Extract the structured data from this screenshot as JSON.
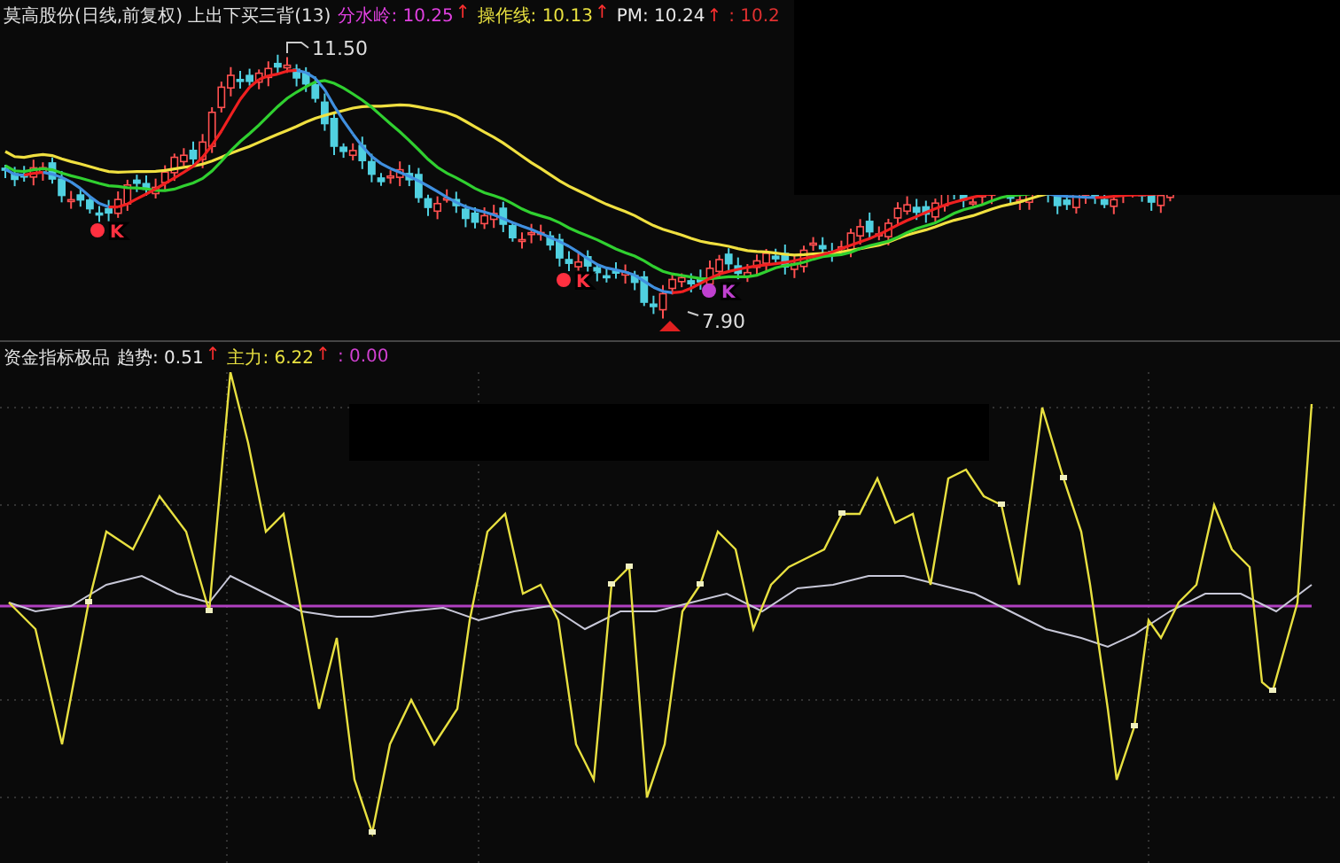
{
  "upper_panel": {
    "title": "莫高股份(日线,前复权) 上出下买三背(13)",
    "indicators": [
      {
        "label": "分水岭: 10.25",
        "arrow": "↑",
        "color": "#e040e0"
      },
      {
        "label": "操作线: 10.13",
        "arrow": "↑",
        "color": "#e8e040"
      },
      {
        "label": "PM: 10.24",
        "arrow": "↑",
        "color": "#e8e8e8"
      },
      {
        "label": ": 10.2",
        "color": "#e03030"
      }
    ],
    "price_labels": [
      "11.50",
      "7.90"
    ],
    "markers": [
      {
        "label": "K",
        "color": "#ff3040"
      },
      {
        "label": "K",
        "color": "#ff3040"
      },
      {
        "label": "K",
        "color": "#c040d0"
      }
    ]
  },
  "lower_panel": {
    "title": "资金指标极品",
    "indicators": [
      {
        "label": "趋势: 0.51",
        "arrow": "↑",
        "color": "#e8e8e8"
      },
      {
        "label": "主力: 6.22",
        "arrow": "↑",
        "color": "#e8e040"
      },
      {
        "label": ": 0.00",
        "color": "#d040d0"
      }
    ]
  }
}
